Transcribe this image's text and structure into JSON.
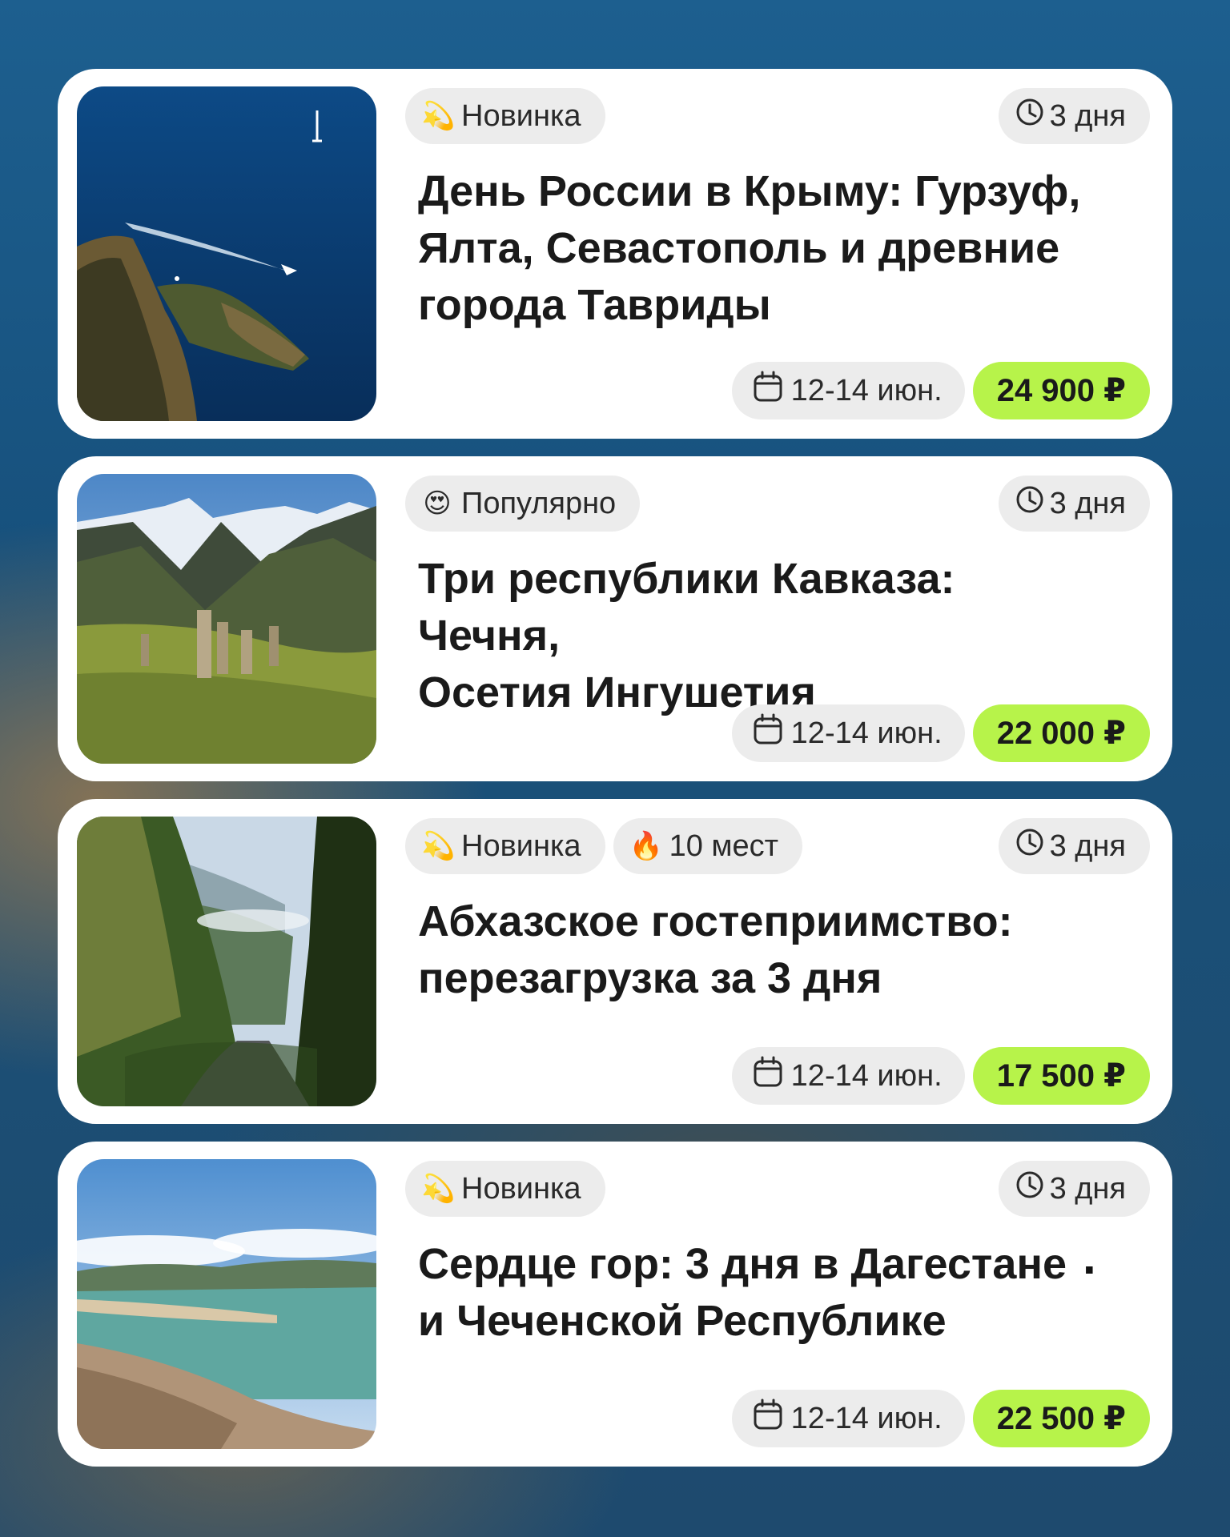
{
  "tours": [
    {
      "tags": [
        {
          "emoji": "💫",
          "label": "Новинка"
        }
      ],
      "duration": "3 дня",
      "title": "День России в Крыму: Гурзуф,\nЯлта, Севастополь и древние\nгорода Тавриды",
      "date": "12-14 июн.",
      "price": "24 900 ₽",
      "image": "sea-cliffs-with-boat"
    },
    {
      "tags": [
        {
          "emoji": "😍",
          "label": "Популярно"
        }
      ],
      "duration": "3 дня",
      "title": "Три республики Кавказа: Чечня,\nОсетия Ингушетия",
      "date": "12-14 июн.",
      "price": "22 000 ₽",
      "image": "mountain-towers"
    },
    {
      "tags": [
        {
          "emoji": "💫",
          "label": "Новинка"
        },
        {
          "emoji": "🔥",
          "label": "10 мест"
        }
      ],
      "duration": "3 дня",
      "title": " Абхазское гостеприимство:\nперезагрузка за 3 дня",
      "date": "12-14 июн.",
      "price": "17 500 ₽",
      "image": "gorge-road"
    },
    {
      "tags": [
        {
          "emoji": "💫",
          "label": "Новинка"
        }
      ],
      "duration": "3 дня",
      "title": "Сердце гор: 3 дня в Дагестане\nи Чеченской Республике",
      "date": "12-14 июн.",
      "price": "22 500 ₽",
      "image": "mountain-lake"
    }
  ],
  "colors": {
    "price_bg": "#b7f34a",
    "pill_bg": "#ececec",
    "card_bg": "#ffffff"
  }
}
